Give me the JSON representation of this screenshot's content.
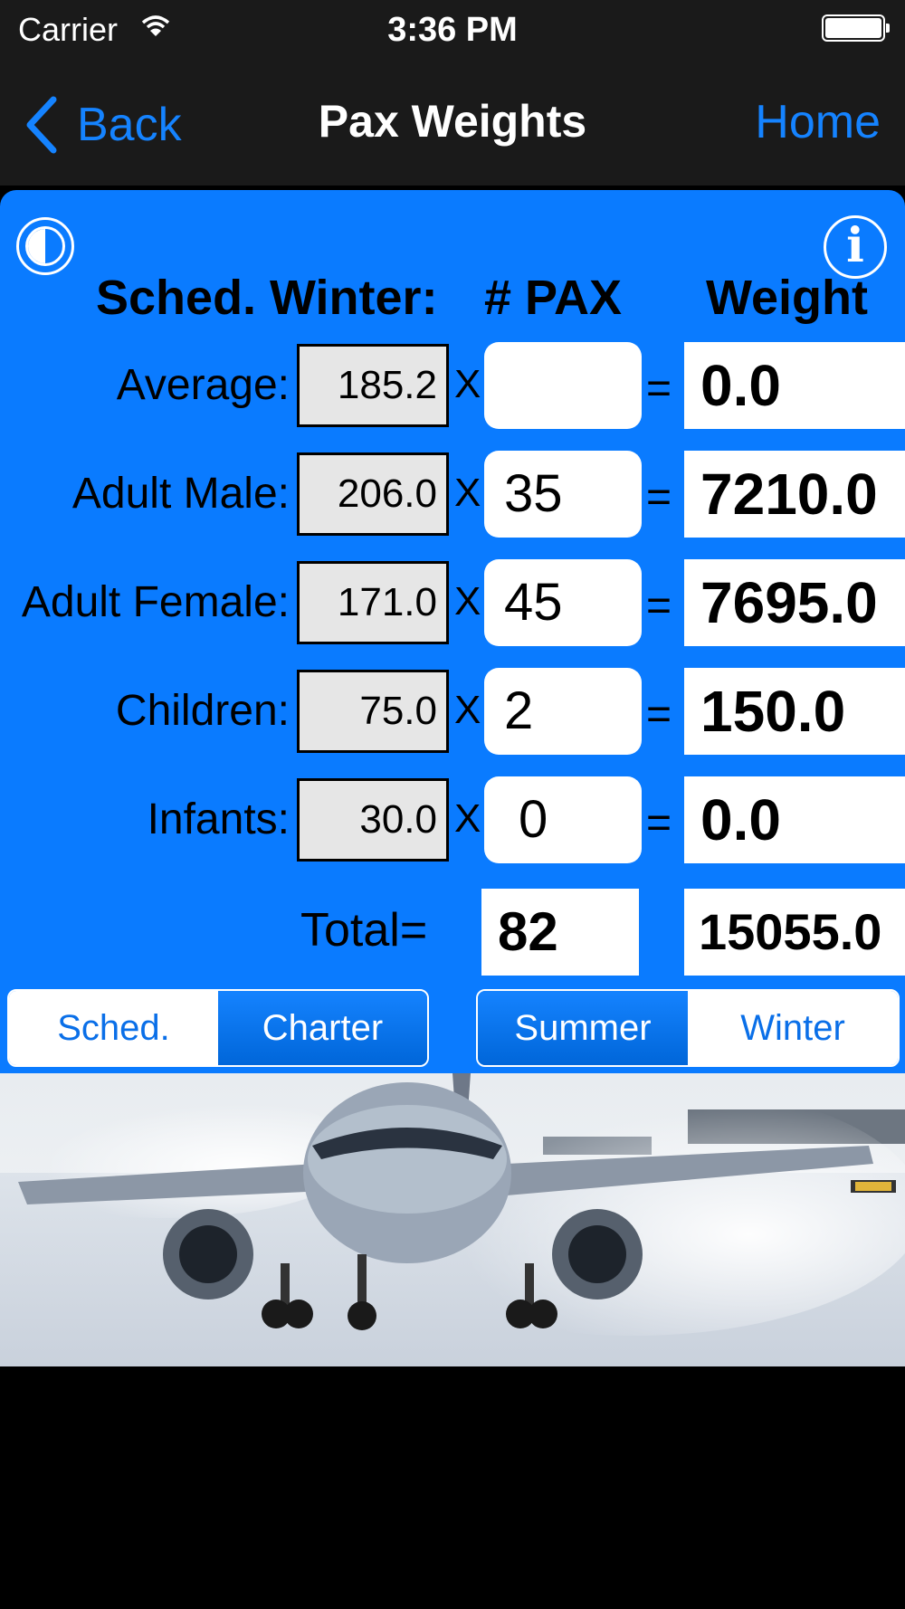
{
  "status_bar": {
    "carrier": "Carrier",
    "time": "3:36 PM"
  },
  "nav": {
    "back_label": "Back",
    "title": "Pax Weights",
    "home_label": "Home"
  },
  "headers": {
    "category": "Sched. Winter:",
    "pax": "# PAX",
    "weight": "Weight"
  },
  "rows": [
    {
      "label": "Average:",
      "factor": "185.2",
      "times": "X",
      "pax": "",
      "equals": "=",
      "weight": "0.0"
    },
    {
      "label": "Adult Male:",
      "factor": "206.0",
      "times": "X",
      "pax": "35",
      "equals": "=",
      "weight": "7210.0"
    },
    {
      "label": "Adult Female:",
      "factor": "171.0",
      "times": "X",
      "pax": "45",
      "equals": "=",
      "weight": "7695.0"
    },
    {
      "label": "Children:",
      "factor": "75.0",
      "times": "X",
      "pax": "2",
      "equals": "=",
      "weight": "150.0"
    },
    {
      "label": "Infants:",
      "factor": "30.0",
      "times": "X",
      "pax": "0",
      "equals": "=",
      "weight": "0.0"
    }
  ],
  "totals": {
    "label": "Total=",
    "pax": "82",
    "weight": "15055.0"
  },
  "flight_type": {
    "options": [
      "Sched.",
      "Charter"
    ],
    "selected": "Charter"
  },
  "season": {
    "options": [
      "Summer",
      "Winter"
    ],
    "selected": "Summer"
  },
  "colors": {
    "accent": "#1583ff",
    "panel": "#0a7bff",
    "nav_background": "#1a1a1a"
  },
  "icons": [
    "wifi-icon",
    "battery-icon",
    "back-chevron-icon",
    "contrast-icon",
    "info-icon"
  ]
}
